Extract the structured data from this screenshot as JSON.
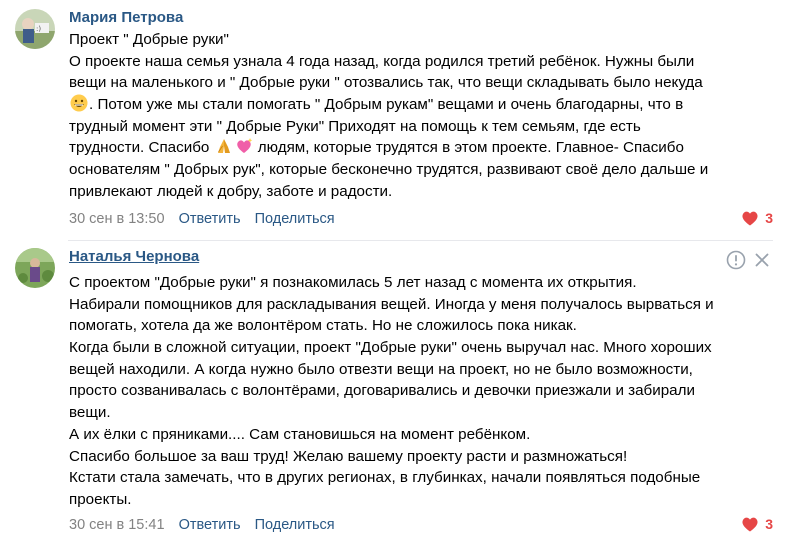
{
  "comments": [
    {
      "author": "Мария Петрова",
      "lines": [
        "Проект \" Добрые руки\"",
        "О проекте наша семья узнала 4 года назад, когда родился третий ребёнок. Нужны были",
        "вещи на маленького и \" Добрые руки \" отозвались так, что вещи складывать было некуда",
        ". Потом уже мы стали помогать \" Добрым рукам\" вещами и очень благодарны, что в",
        "трудный момент эти \" Добрые Руки\" Приходят на помощь к тем семьям, где есть",
        "трудности. Спасибо ",
        " людям, которые трудятся в этом проекте. Главное- Спасибо",
        "основателям \" Добрых рук\", которые бесконечно трудятся, развивают своё дело дальше и",
        "привлекают людей к добру, заботе и радости."
      ],
      "date": "30 сен в 13:50",
      "reply_label": "Ответить",
      "share_label": "Поделиться",
      "likes": "3"
    },
    {
      "author": "Наталья Чернова",
      "lines": [
        "С проектом \"Добрые руки\" я познакомилась 5 лет назад с момента их открытия.",
        "Набирали помощников для раскладывания вещей. Иногда у меня получалось вырваться и",
        "помогать, хотела да же волонтёром стать. Но не сложилось пока никак.",
        "Когда были в сложной ситуации, проект \"Добрые руки\" очень выручал нас. Много хороших",
        "вещей находили. А когда нужно было отвезти вещи на проект, но не было возможности,",
        "просто созванивалась с волонтёрами, договаривались и девочки приезжали и забирали",
        "вещи.",
        "А их ёлки с пряниками.... Сам становишься на момент ребёнком.",
        "Спасибо большое за ваш труд! Желаю вашему проекту расти и размножаться!",
        "Кстати стала замечать, что в других регионах, в глубинках, начали появляться подобные",
        "проекты."
      ],
      "date": "30 сен в 15:41",
      "reply_label": "Ответить",
      "share_label": "Поделиться",
      "likes": "3"
    }
  ],
  "icons": {
    "emoji_1": "grinning-face-icon",
    "emoji_2": "folded-hands-icon",
    "emoji_3": "sparkling-heart-icon",
    "like": "heart-icon",
    "report": "exclamation-circle-icon",
    "close": "close-icon"
  },
  "colors": {
    "link": "#2a5885",
    "meta": "#828282",
    "like": "#e64646",
    "divider": "#e7e8ec"
  }
}
